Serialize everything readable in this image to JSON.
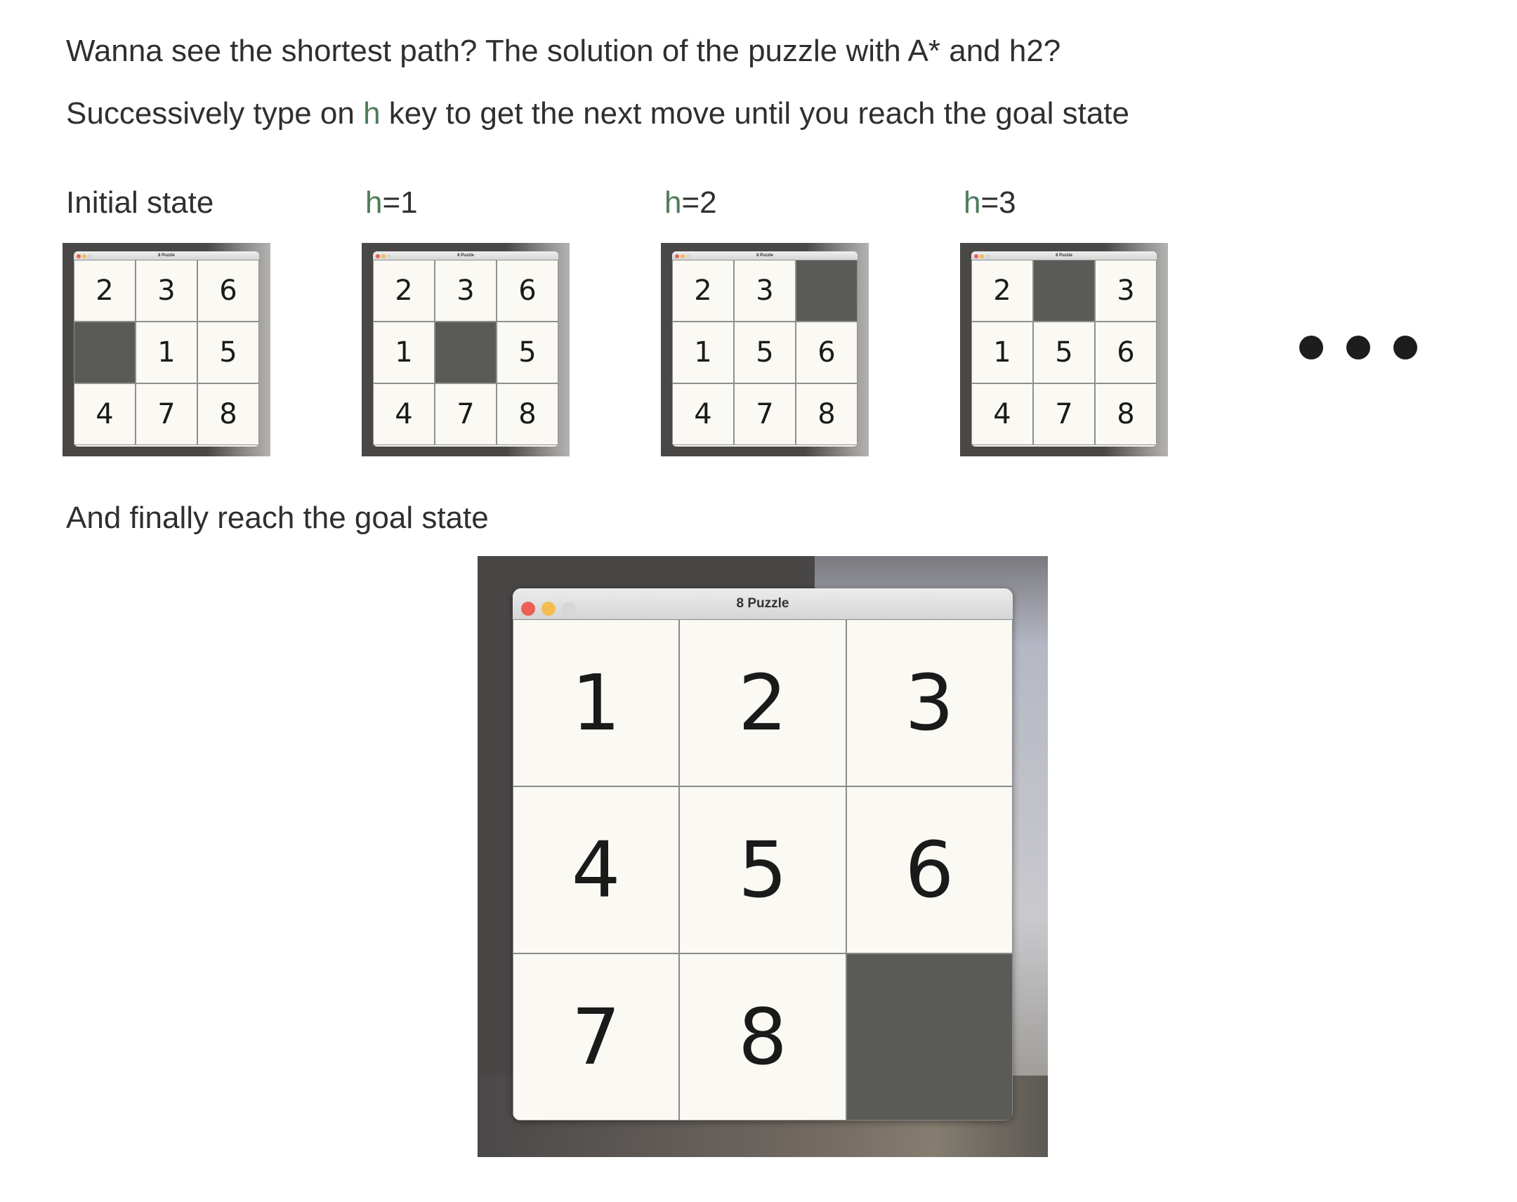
{
  "intro": {
    "line1": "Wanna see the shortest path? The solution of the puzzle with A* and h2?",
    "line2_pre": "Successively type on ",
    "line2_key": "h",
    "line2_post": " key to get the next move until you reach the goal state"
  },
  "steps": [
    {
      "label": "Initial state",
      "key": "",
      "rest": "",
      "tiles": [
        "2",
        "3",
        "6",
        "",
        "1",
        "5",
        "4",
        "7",
        "8"
      ]
    },
    {
      "label": "",
      "key": "h",
      "rest": "=1",
      "tiles": [
        "2",
        "3",
        "6",
        "1",
        "",
        "5",
        "4",
        "7",
        "8"
      ]
    },
    {
      "label": "",
      "key": "h",
      "rest": "=2",
      "tiles": [
        "2",
        "3",
        "",
        "1",
        "5",
        "6",
        "4",
        "7",
        "8"
      ]
    },
    {
      "label": "",
      "key": "h",
      "rest": "=3",
      "tiles": [
        "2",
        "",
        "3",
        "1",
        "5",
        "6",
        "4",
        "7",
        "8"
      ]
    }
  ],
  "finally_text": "And finally reach the goal state",
  "goal": {
    "window_title": "8 Puzzle",
    "tiles": [
      "1",
      "2",
      "3",
      "4",
      "5",
      "6",
      "7",
      "8",
      ""
    ]
  },
  "window": {
    "title_small": "8 Puzzle",
    "traffic_lights": [
      "#ec5f57",
      "#f4bd4f",
      "#d6d6d6"
    ]
  },
  "colors": {
    "accent": "#4e7d5a",
    "blank_tile": "#5a5a57",
    "tile": "#fbf9f4"
  }
}
